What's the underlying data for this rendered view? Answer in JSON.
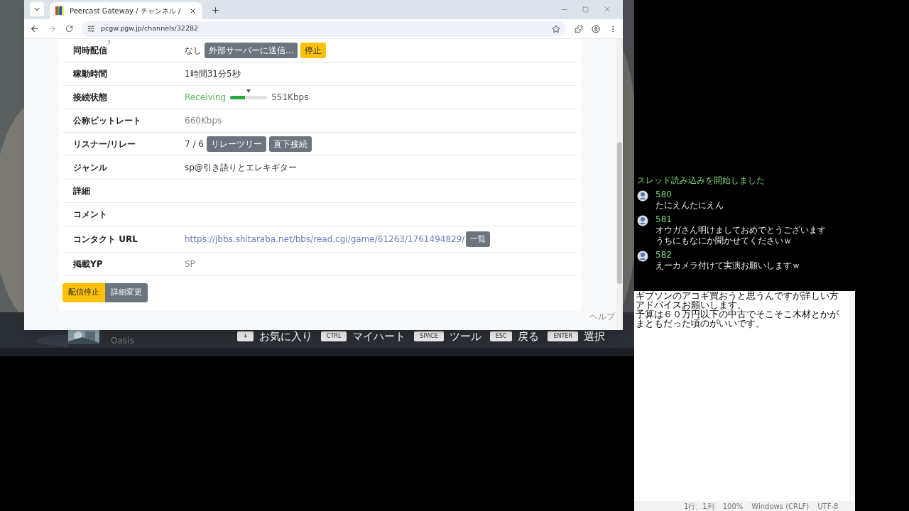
{
  "browser": {
    "tab_title": "Peercast Gateway / チャンネル /",
    "url": "pcgw.pgw.jp/channels/32282"
  },
  "rows": [
    {
      "label": "同時配信",
      "note": "?",
      "kind": "buttons",
      "value": "なし",
      "buttons": [
        {
          "label": "外部サーバーに送信...",
          "kind": "secondary"
        },
        {
          "label": "停止",
          "kind": "warning"
        }
      ]
    },
    {
      "label": "稼動時間",
      "kind": "text",
      "value": "1時間31分5秒"
    },
    {
      "label": "接続状態",
      "kind": "status",
      "value": "Receiving",
      "level": 0.4,
      "reading": "551Kbps"
    },
    {
      "label": "公称ビットレート",
      "kind": "muted",
      "value": "660Kbps"
    },
    {
      "label": "リスナー/リレー",
      "kind": "buttons",
      "value": "7 / 6",
      "buttons": [
        {
          "label": "リレーツリー",
          "kind": "secondary"
        },
        {
          "label": "直下接続",
          "kind": "secondary"
        }
      ]
    },
    {
      "label": "ジャンル",
      "kind": "text",
      "value": "sp@引き語りとエレキギター"
    },
    {
      "label": "詳細",
      "kind": "empty"
    },
    {
      "label": "コメント",
      "kind": "empty"
    },
    {
      "label": "コンタクト URL",
      "kind": "link",
      "value": "https://jbbs.shitaraba.net/bbs/read.cgi/game/61263/1761494829/",
      "buttons": [
        {
          "label": "一覧",
          "kind": "secondary"
        }
      ]
    },
    {
      "label": "掲載YP",
      "kind": "muted",
      "value": "SP"
    }
  ],
  "actions": [
    {
      "label": "配信停止",
      "kind": "warning"
    },
    {
      "label": "詳細変更",
      "kind": "secondary"
    }
  ],
  "help": "ヘルプ",
  "game_bar": {
    "title": "Oasis",
    "hints": [
      {
        "key": "+",
        "label": "お気に入り"
      },
      {
        "key": "CTRL",
        "label": "マイハート"
      },
      {
        "key": "SPACE",
        "label": "ツール"
      },
      {
        "key": "ESC",
        "label": "戻る"
      },
      {
        "key": "ENTER",
        "label": "選択"
      }
    ]
  },
  "chat": {
    "status": "スレッド読み込みを開始しました",
    "posts": [
      {
        "number": "580",
        "lines": [
          "たにえんたにえん"
        ]
      },
      {
        "number": "581",
        "lines": [
          "オウガさん明けましておめでとうございます",
          "うちにもなにか聞かせてくださいｗ"
        ]
      },
      {
        "number": "582",
        "lines": [
          "えーカメラ付けて実演お願いしますｗ"
        ]
      }
    ]
  },
  "notepad": {
    "lines": [
      "ギブソンのアコギ買おうと思うんですが詳しい方",
      "アドバイスお願いします。",
      "予算は６０万円以下の中古でそこそこ木材とかが",
      "まともだった頃のがいいです。"
    ],
    "status": [
      "1行、1列",
      "100%",
      "Windows (CRLF)",
      "UTF-8"
    ]
  }
}
